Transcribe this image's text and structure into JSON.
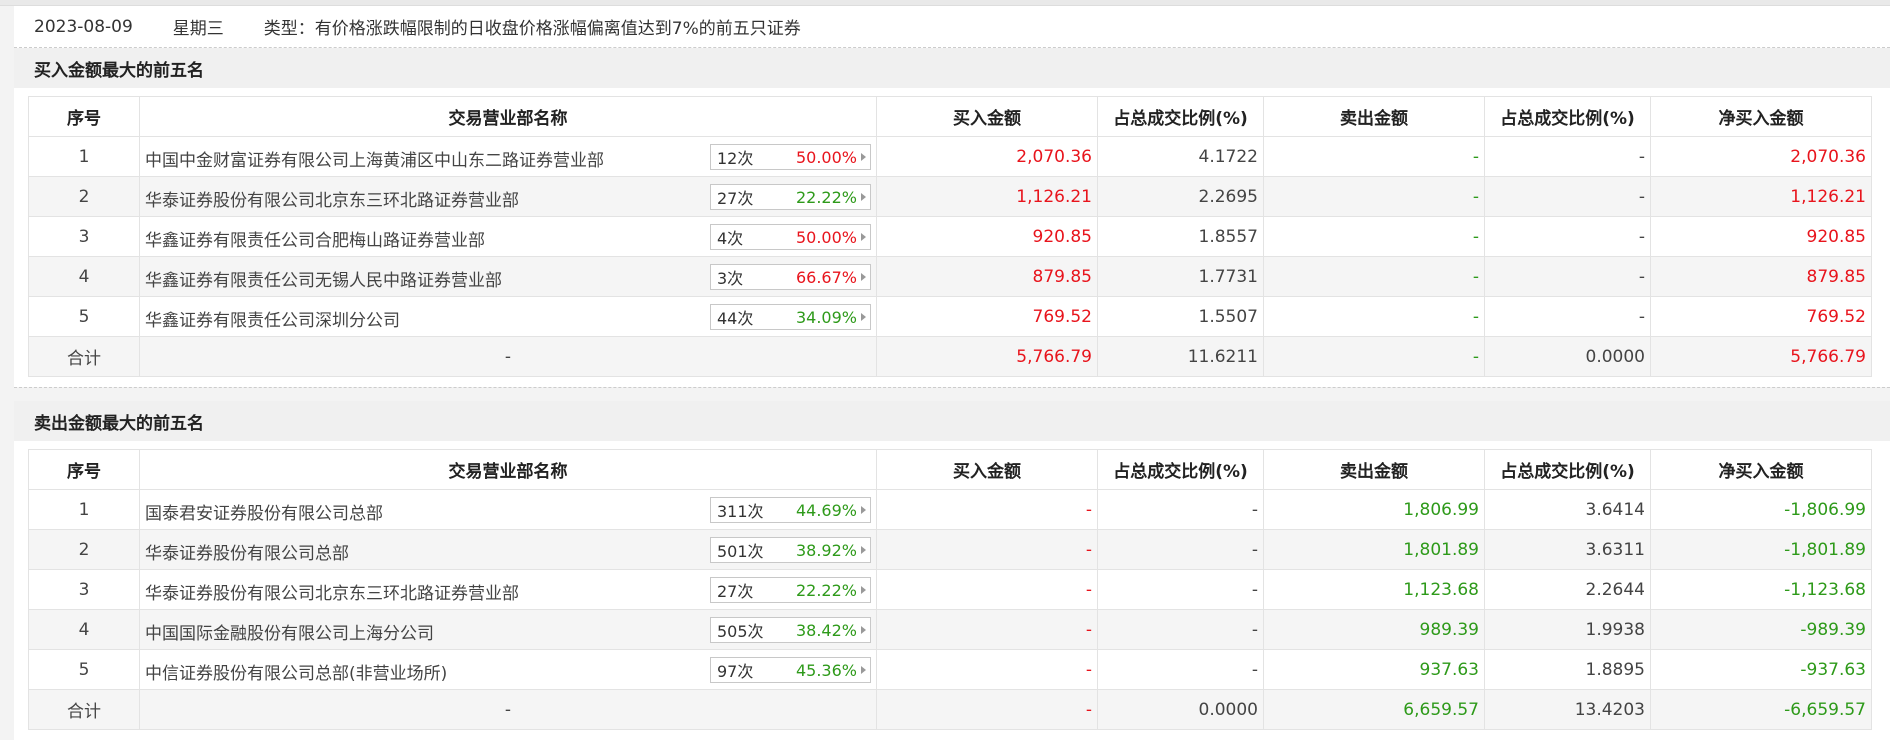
{
  "header": {
    "date": "2023-08-09",
    "weekday": "星期三",
    "type_label": "类型：有价格涨跌幅限制的日收盘价格涨幅偏离值达到7%的前五只证券"
  },
  "columns": [
    "序号",
    "交易营业部名称",
    "买入金额",
    "占总成交比例(%)",
    "卖出金额",
    "占总成交比例(%)",
    "净买入金额"
  ],
  "colors": {
    "up": "#e8141c",
    "down": "#2e9a1a"
  },
  "buy_section": {
    "title": "买入金额最大的前五名",
    "rows": [
      {
        "idx": "1",
        "name": "中国中金财富证券有限公司上海黄浦区中山东二路证券营业部",
        "count": "12次",
        "pct": "50.00%",
        "pct_color": "red",
        "buy": "2,070.36",
        "buy_ratio": "4.1722",
        "sell": "-",
        "sell_ratio": "-",
        "net": "2,070.36"
      },
      {
        "idx": "2",
        "name": "华泰证券股份有限公司北京东三环北路证券营业部",
        "count": "27次",
        "pct": "22.22%",
        "pct_color": "green",
        "buy": "1,126.21",
        "buy_ratio": "2.2695",
        "sell": "-",
        "sell_ratio": "-",
        "net": "1,126.21"
      },
      {
        "idx": "3",
        "name": "华鑫证券有限责任公司合肥梅山路证券营业部",
        "count": "4次",
        "pct": "50.00%",
        "pct_color": "red",
        "buy": "920.85",
        "buy_ratio": "1.8557",
        "sell": "-",
        "sell_ratio": "-",
        "net": "920.85"
      },
      {
        "idx": "4",
        "name": "华鑫证券有限责任公司无锡人民中路证券营业部",
        "count": "3次",
        "pct": "66.67%",
        "pct_color": "red",
        "buy": "879.85",
        "buy_ratio": "1.7731",
        "sell": "-",
        "sell_ratio": "-",
        "net": "879.85"
      },
      {
        "idx": "5",
        "name": "华鑫证券有限责任公司深圳分公司",
        "count": "44次",
        "pct": "34.09%",
        "pct_color": "green",
        "buy": "769.52",
        "buy_ratio": "1.5507",
        "sell": "-",
        "sell_ratio": "-",
        "net": "769.52"
      }
    ],
    "total": {
      "label": "合计",
      "name": "-",
      "buy": "5,766.79",
      "buy_ratio": "11.6211",
      "sell": "-",
      "sell_ratio": "0.0000",
      "net": "5,766.79"
    }
  },
  "sell_section": {
    "title": "卖出金额最大的前五名",
    "rows": [
      {
        "idx": "1",
        "name": "国泰君安证券股份有限公司总部",
        "count": "311次",
        "pct": "44.69%",
        "pct_color": "green",
        "buy": "-",
        "buy_ratio": "-",
        "sell": "1,806.99",
        "sell_ratio": "3.6414",
        "net": "-1,806.99"
      },
      {
        "idx": "2",
        "name": "华泰证券股份有限公司总部",
        "count": "501次",
        "pct": "38.92%",
        "pct_color": "green",
        "buy": "-",
        "buy_ratio": "-",
        "sell": "1,801.89",
        "sell_ratio": "3.6311",
        "net": "-1,801.89"
      },
      {
        "idx": "3",
        "name": "华泰证券股份有限公司北京东三环北路证券营业部",
        "count": "27次",
        "pct": "22.22%",
        "pct_color": "green",
        "buy": "-",
        "buy_ratio": "-",
        "sell": "1,123.68",
        "sell_ratio": "2.2644",
        "net": "-1,123.68"
      },
      {
        "idx": "4",
        "name": "中国国际金融股份有限公司上海分公司",
        "count": "505次",
        "pct": "38.42%",
        "pct_color": "green",
        "buy": "-",
        "buy_ratio": "-",
        "sell": "989.39",
        "sell_ratio": "1.9938",
        "net": "-989.39"
      },
      {
        "idx": "5",
        "name": "中信证券股份有限公司总部(非营业场所)",
        "count": "97次",
        "pct": "45.36%",
        "pct_color": "green",
        "buy": "-",
        "buy_ratio": "-",
        "sell": "937.63",
        "sell_ratio": "1.8895",
        "net": "-937.63"
      }
    ],
    "total": {
      "label": "合计",
      "name": "-",
      "buy": "-",
      "buy_ratio": "0.0000",
      "sell": "6,659.57",
      "sell_ratio": "13.4203",
      "net": "-6,659.57"
    }
  }
}
